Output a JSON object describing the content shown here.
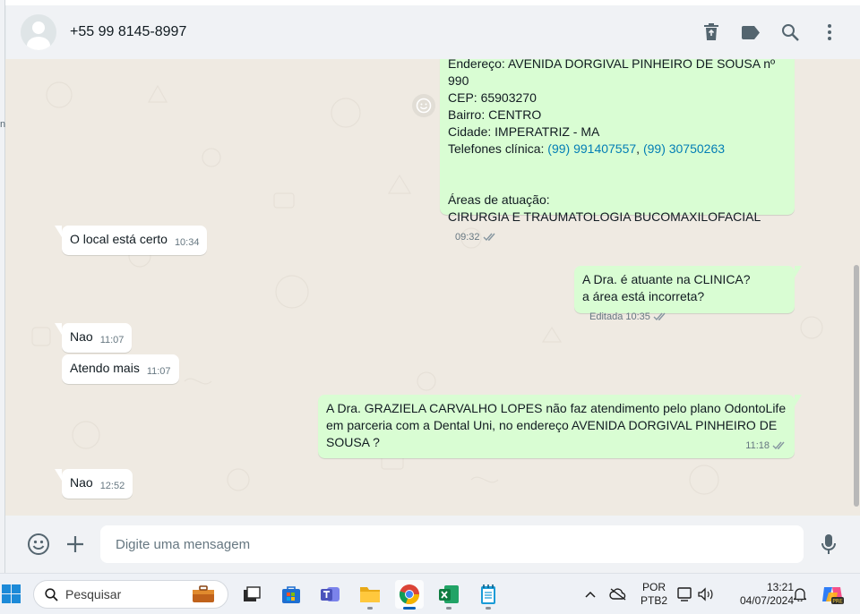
{
  "left_edge": {
    "fragment": "n"
  },
  "header": {
    "contact_name": "+55 99 8145-8997",
    "icons": [
      "delete-icon",
      "label-icon",
      "search-icon",
      "menu-icon"
    ]
  },
  "messages": {
    "m1": {
      "line_address": "Endereço: AVENIDA DORGIVAL PINHEIRO DE SOUSA nº 990",
      "line_cep": "CEP: 65903270",
      "line_bairro": "Bairro: CENTRO",
      "line_cidade": "Cidade: IMPERATRIZ - MA",
      "phones_label": "Telefones clínica: ",
      "phone1": "(99) 991407557",
      "phone_sep": ", ",
      "phone2": "(99) 30750263",
      "areas_label": "Áreas de atuação:",
      "areas_value": "CIRURGIA E TRAUMATOLOGIA BUCOMAXILOFACIAL",
      "time": "09:32"
    },
    "m2": {
      "text": "O local está certo",
      "time": "10:34"
    },
    "m3": {
      "line1": "A Dra. é atuante na CLINICA?",
      "line2": "a área está incorreta?",
      "edited": "Editada",
      "time": "10:35"
    },
    "m4": {
      "text": "Nao",
      "time": "11:07"
    },
    "m5": {
      "text": "Atendo mais",
      "time": "11:07"
    },
    "m6": {
      "line1": "A Dra. GRAZIELA CARVALHO LOPES não faz atendimento pelo plano OdontoLife",
      "line2": "em parceria com a Dental Uni, no endereço AVENIDA DORGIVAL PINHEIRO DE",
      "line3": "SOUSA ?",
      "time": "11:18"
    },
    "m7": {
      "text": "Nao",
      "time": "12:52"
    }
  },
  "composer": {
    "placeholder": "Digite uma mensagem"
  },
  "taskbar": {
    "search_label": "Pesquisar",
    "lang_top": "POR",
    "lang_bottom": "PTB2",
    "time": "13:21",
    "date": "04/07/2024"
  },
  "colors": {
    "outgoing_bubble": "#d9fdd3",
    "incoming_bubble": "#ffffff",
    "chat_background": "#efeae2",
    "link": "#027eb5",
    "panel": "#f0f2f5"
  }
}
